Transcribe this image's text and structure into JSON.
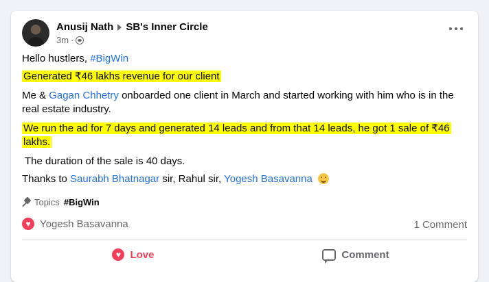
{
  "post": {
    "author": "Anusij Nath",
    "group": "SB's Inner Circle",
    "time": "3m",
    "greeting_text": "Hello hustlers,",
    "greeting_tag": "#BigWin",
    "highlight1": "Generated ₹46 lakhs revenue for our client",
    "p1_start": "Me &",
    "p1_mention": "Gagan Chhetry",
    "p1_rest": "onboarded one client in March and started working with him who is in the",
    "p1_line2": "real estate industry.",
    "highlight2_line1": "We run the ad for 7 days and generated 14 leads and from that 14 leads, he got 1 sale of ₹46",
    "highlight2_line2": "lakhs.",
    "duration": "The duration of the sale is 40 days.",
    "thanks_start": "Thanks to",
    "thanks_mention1": "Saurabh Bhatnagar",
    "thanks_mid": "sir, Rahul sir,",
    "thanks_mention2": "Yogesh Basavanna"
  },
  "topics": {
    "label": "Topics",
    "tag": "#BigWin"
  },
  "reactions": {
    "reactor": "Yogesh Basavanna",
    "comments": "1 Comment"
  },
  "actions": {
    "love": "Love",
    "comment": "Comment"
  }
}
